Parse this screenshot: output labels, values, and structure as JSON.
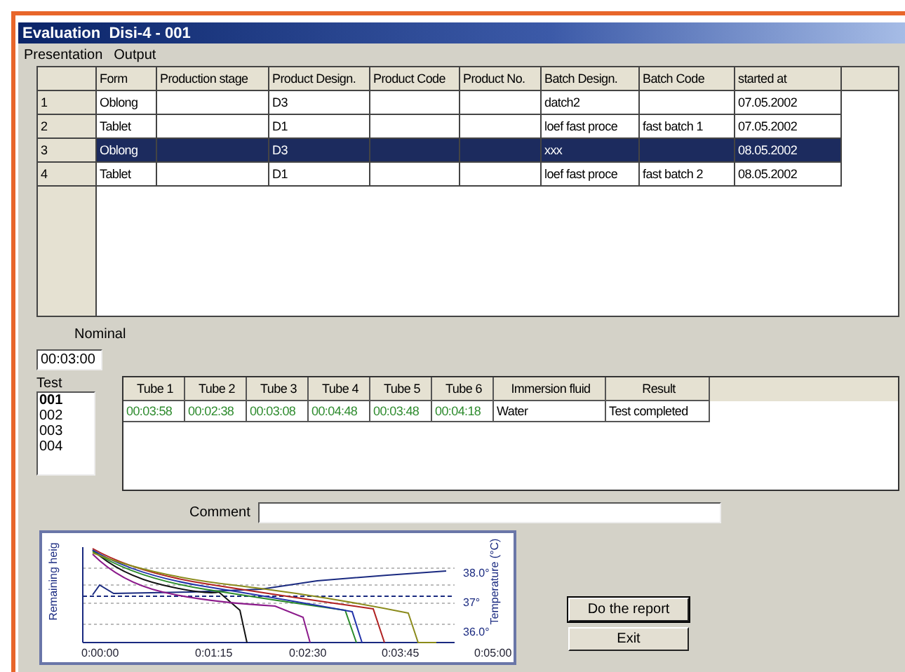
{
  "window": {
    "title": "Evaluation  Disi-4 - 001"
  },
  "menu": [
    "Presentation",
    "Output"
  ],
  "table": {
    "columns": [
      "Form",
      "Production stage",
      "Product Design.",
      "Product Code",
      "Product No.",
      "Batch Design.",
      "Batch Code",
      "started at"
    ],
    "rows": [
      {
        "number": "1",
        "selected": false,
        "cells": [
          "Oblong",
          "",
          "D3",
          "",
          "",
          "datch2",
          "",
          "07.05.2002"
        ]
      },
      {
        "number": "2",
        "selected": false,
        "cells": [
          "Tablet",
          "",
          "D1",
          "",
          "",
          "loef fast proce",
          "fast batch 1",
          "07.05.2002"
        ]
      },
      {
        "number": "3",
        "selected": true,
        "cells": [
          "Oblong",
          "",
          "D3",
          "",
          "",
          "xxx",
          "",
          "08.05.2002"
        ]
      },
      {
        "number": "4",
        "selected": false,
        "cells": [
          "Tablet",
          "",
          "D1",
          "",
          "",
          "loef fast proce",
          "fast batch 2",
          "08.05.2002"
        ]
      }
    ]
  },
  "nominal": {
    "label": "Nominal",
    "value": "00:03:00"
  },
  "test": {
    "label": "Test",
    "items": [
      {
        "label": "001",
        "selected": true
      },
      {
        "label": "002",
        "selected": false
      },
      {
        "label": "003",
        "selected": false
      },
      {
        "label": "004",
        "selected": false
      }
    ]
  },
  "results": {
    "columns": [
      "Tube 1",
      "Tube 2",
      "Tube 3",
      "Tube 4",
      "Tube 5",
      "Tube 6",
      "Immersion fluid",
      "Result"
    ],
    "rows": [
      {
        "tubes": [
          "00:03:58",
          "00:02:38",
          "00:03:08",
          "00:04:48",
          "00:03:48",
          "00:04:18"
        ],
        "fluid": "Water",
        "result": "Test completed"
      }
    ]
  },
  "comment": {
    "label": "Comment"
  },
  "chart": {
    "ylabel": "Remaining heig",
    "y2label": "Temperature (°C)",
    "xticks": [
      "0:00:00",
      "0:01:15",
      "0:02:30",
      "0:03:45",
      "0:05:00"
    ],
    "y2ticks": [
      "38.0°",
      "37°",
      "36.0°"
    ]
  },
  "buttons": [
    "Do the report",
    "Exit"
  ]
}
